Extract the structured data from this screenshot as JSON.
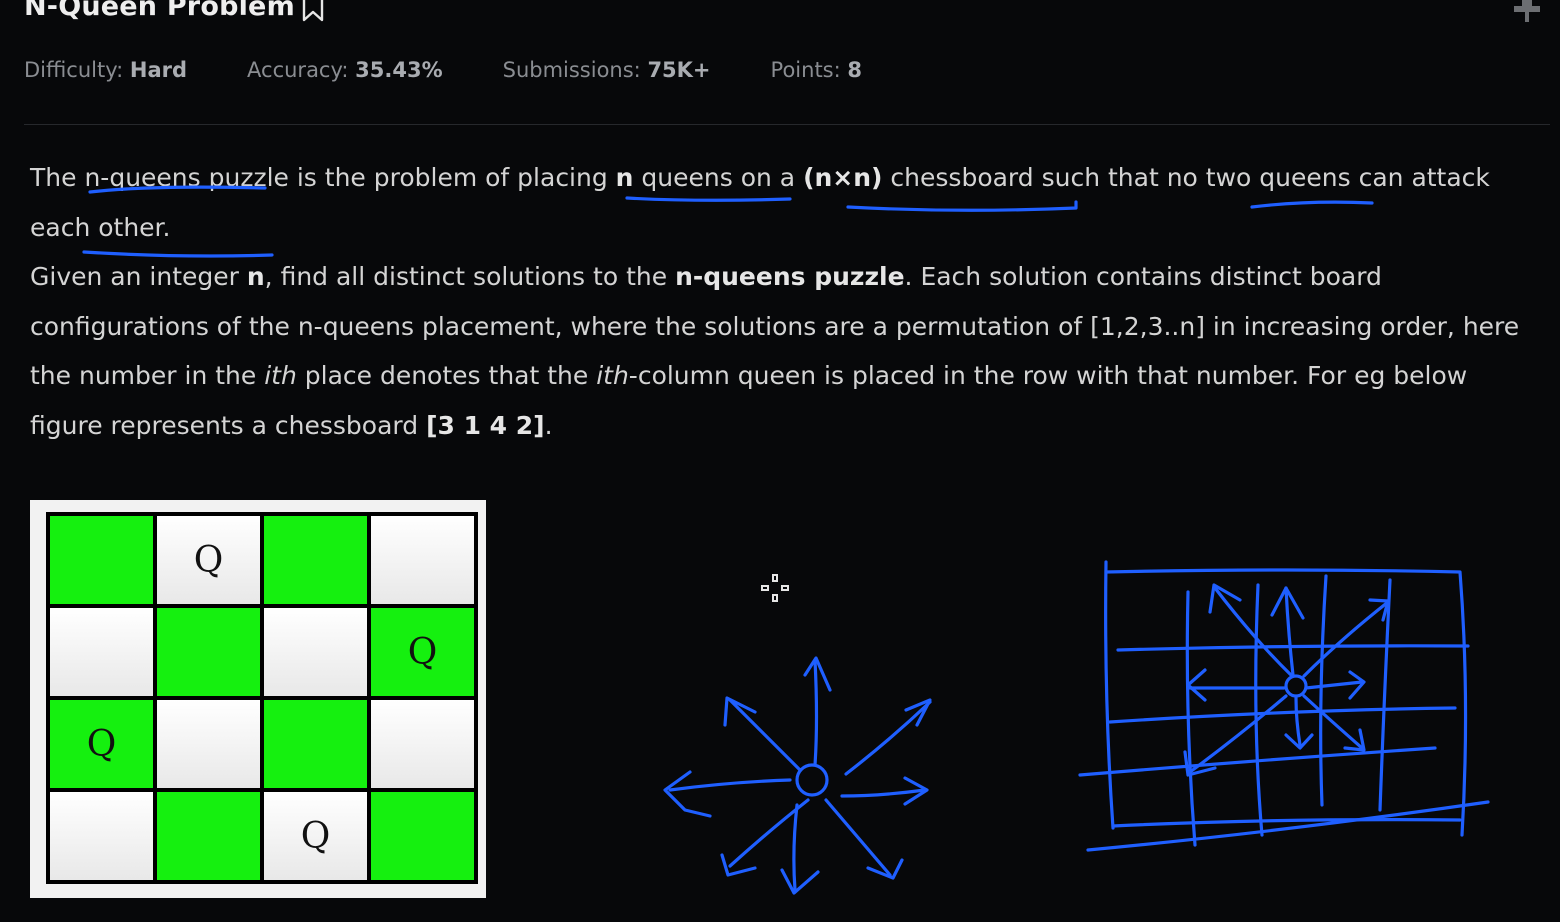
{
  "header": {
    "title": "N-Queen Problem"
  },
  "meta": [
    {
      "label": "Difficulty: ",
      "value": "Hard"
    },
    {
      "label": "Accuracy: ",
      "value": "35.43%"
    },
    {
      "label": "Submissions: ",
      "value": "75K+"
    },
    {
      "label": "Points: ",
      "value": "8"
    }
  ],
  "description": {
    "p1": {
      "s1": "The ",
      "u1": "n-queens puzzle",
      "s2": " is the problem of placing ",
      "b1": "n",
      "s3": " queens on a ",
      "b2": "(n×n)",
      "s4": " chessboard such that no two queens can attack each other."
    },
    "p2": {
      "s1": "Given an integer ",
      "b1": "n",
      "s2": ", find all distinct solutions to the ",
      "b2": "n-queens puzzle",
      "s3": ". Each solution contains distinct board configurations of the n-queens placement, where the solutions are a permutation of [1,2,3..n] in increasing order, here the number in the ",
      "i1": "ith",
      "s4": " place denotes that the ",
      "i2": "ith",
      "s5": "-column queen is placed in the row with that number. For eg below figure represents a chessboard ",
      "b3": "[3 1 4 2]",
      "s6": "."
    }
  },
  "board": {
    "queen_symbol": "Q",
    "queen_rows_by_column": [
      3,
      1,
      4,
      2
    ],
    "colors": {
      "green": "#15f00f",
      "white": "#ffffff",
      "border": "#000000"
    }
  },
  "annotations": {
    "ink_color": "#1f5fff",
    "icons": [
      "queen-moves-sketch",
      "grid-sketch",
      "move-cursor-icon"
    ]
  }
}
